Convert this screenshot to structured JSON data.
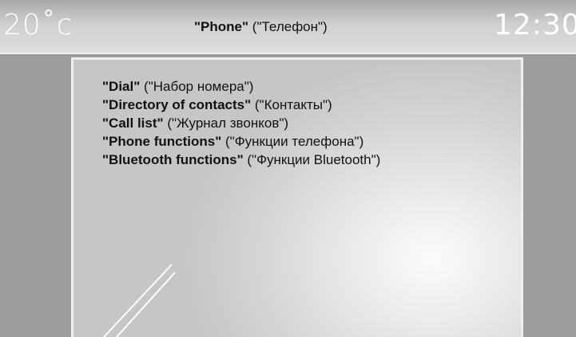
{
  "header": {
    "temperature": "20˚c",
    "title_en": "\"Phone\"",
    "title_ru": " (\"Телефон\")",
    "clock": "12:30"
  },
  "menu": {
    "items": [
      {
        "en": "\"Dial\"",
        "ru": " (\"Набор номера\")"
      },
      {
        "en": "\"Directory of contacts\"",
        "ru": " (\"Контакты\")"
      },
      {
        "en": "\"Call list\"",
        "ru": " (\"Журнал звонков\")"
      },
      {
        "en": "\"Phone functions\"",
        "ru": " (\"Функции телефона\")"
      },
      {
        "en": "\"Bluetooth functions\"",
        "ru": " (\"Функции Bluetooth\")"
      }
    ]
  },
  "colors": {
    "screen_background": "#9d9d9d",
    "panel_border": "#efefef",
    "text": "#111111",
    "header_text": "#ffffff"
  }
}
